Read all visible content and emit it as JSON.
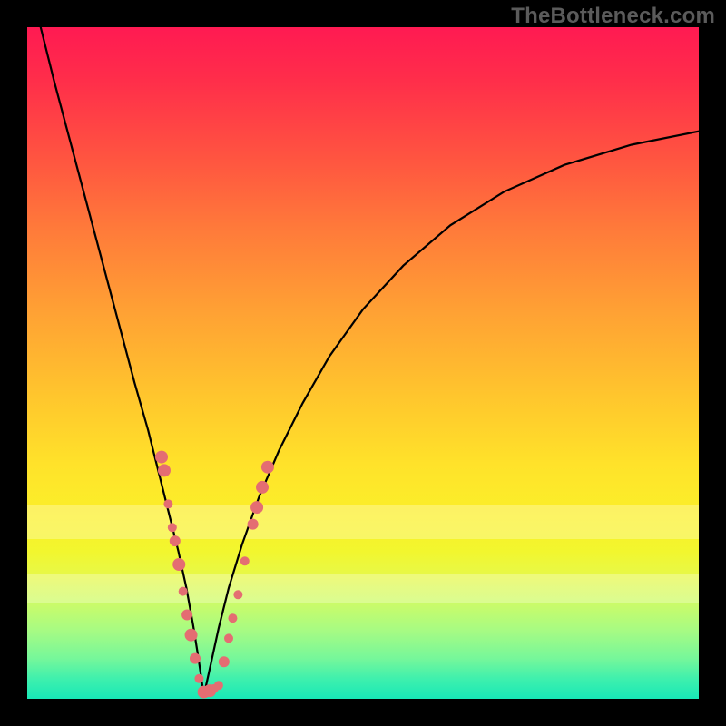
{
  "watermark": "TheBottleneck.com",
  "chart_data": {
    "type": "line",
    "title": "",
    "xlabel": "",
    "ylabel": "",
    "xlim": [
      0,
      100
    ],
    "ylim": [
      0,
      100
    ],
    "series": [
      {
        "name": "left-arm",
        "x": [
          2,
          4,
          6,
          8,
          10,
          12,
          14,
          16,
          18,
          19.5,
          21,
          22.5,
          23.7,
          24.7,
          25.5,
          26.3
        ],
        "values": [
          100,
          92,
          84.5,
          77,
          69.5,
          62,
          54.5,
          47,
          40,
          34,
          28,
          22,
          16.5,
          11,
          6,
          0.5
        ]
      },
      {
        "name": "right-arm",
        "x": [
          26.3,
          27.3,
          28.5,
          30,
          32,
          34.5,
          37.5,
          41,
          45,
          50,
          56,
          63,
          71,
          80,
          90,
          100
        ],
        "values": [
          0.5,
          5,
          10.5,
          16.5,
          23,
          30,
          37,
          44,
          51,
          58,
          64.5,
          70.5,
          75.5,
          79.5,
          82.5,
          84.5
        ]
      }
    ],
    "markers": {
      "name": "overlay-dots",
      "color": "#e46d72",
      "points": [
        {
          "x": 20.0,
          "y": 36.0,
          "r": 7
        },
        {
          "x": 20.4,
          "y": 34.0,
          "r": 7
        },
        {
          "x": 21.0,
          "y": 29.0,
          "r": 5
        },
        {
          "x": 21.6,
          "y": 25.5,
          "r": 5
        },
        {
          "x": 22.0,
          "y": 23.5,
          "r": 6
        },
        {
          "x": 22.6,
          "y": 20.0,
          "r": 7
        },
        {
          "x": 23.2,
          "y": 16.0,
          "r": 5
        },
        {
          "x": 23.8,
          "y": 12.5,
          "r": 6
        },
        {
          "x": 24.4,
          "y": 9.5,
          "r": 7
        },
        {
          "x": 25.0,
          "y": 6.0,
          "r": 6
        },
        {
          "x": 25.6,
          "y": 3.0,
          "r": 5
        },
        {
          "x": 26.3,
          "y": 1.0,
          "r": 7
        },
        {
          "x": 27.2,
          "y": 1.2,
          "r": 7
        },
        {
          "x": 27.8,
          "y": 1.5,
          "r": 5
        },
        {
          "x": 28.5,
          "y": 2.0,
          "r": 5
        },
        {
          "x": 29.3,
          "y": 5.5,
          "r": 6
        },
        {
          "x": 30.0,
          "y": 9.0,
          "r": 5
        },
        {
          "x": 30.6,
          "y": 12.0,
          "r": 5
        },
        {
          "x": 31.4,
          "y": 15.5,
          "r": 5
        },
        {
          "x": 32.4,
          "y": 20.5,
          "r": 5
        },
        {
          "x": 33.6,
          "y": 26.0,
          "r": 6
        },
        {
          "x": 34.2,
          "y": 28.5,
          "r": 7
        },
        {
          "x": 35.0,
          "y": 31.5,
          "r": 7
        },
        {
          "x": 35.8,
          "y": 34.5,
          "r": 7
        }
      ]
    },
    "bands": [
      {
        "y": 28.8,
        "height_pct": 5.0
      },
      {
        "y": 18.5,
        "height_pct": 4.2
      }
    ],
    "gradient_stops": [
      {
        "pos": 0,
        "color": "#ff1a52"
      },
      {
        "pos": 50,
        "color": "#ffc62d"
      },
      {
        "pos": 78,
        "color": "#f2f62e"
      },
      {
        "pos": 100,
        "color": "#18e8b7"
      }
    ]
  }
}
